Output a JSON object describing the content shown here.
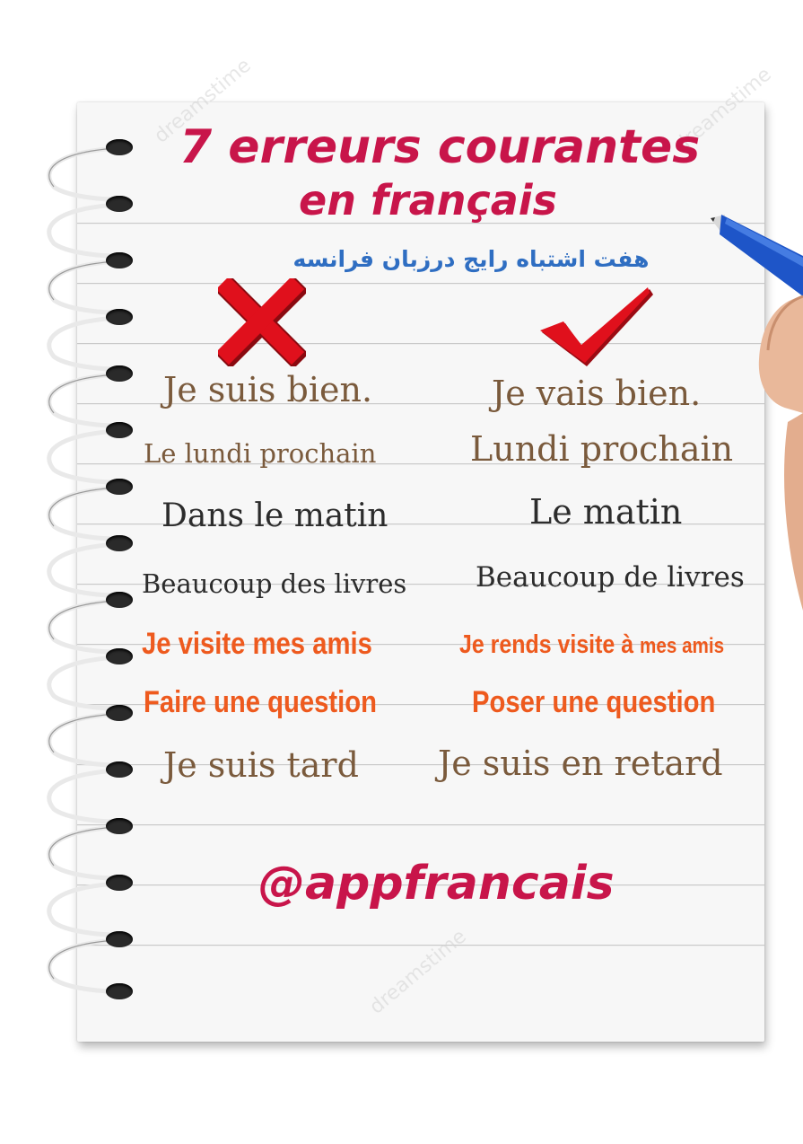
{
  "title": {
    "line1": "7 erreurs courantes",
    "line2": "en français",
    "persian": "هفت اشتباه رایج درزبان فرانسه"
  },
  "columns": {
    "wrong_icon": "red-x-icon",
    "right_icon": "red-checkmark-icon"
  },
  "phrases": [
    {
      "wrong": "Je suis bien.",
      "right": "Je vais bien."
    },
    {
      "wrong": "Le lundi prochain",
      "right": "Lundi prochain"
    },
    {
      "wrong": "Dans le matin",
      "right": "Le matin"
    },
    {
      "wrong": "Beaucoup des livres",
      "right": "Beaucoup de livres"
    },
    {
      "wrong": "Je visite mes amis",
      "right_part1": "Je rends visite à",
      "right_part2": "mes amis"
    },
    {
      "wrong": "Faire une question",
      "right": "Poser une question"
    },
    {
      "wrong": "Je suis tard",
      "right": "Je suis en retard"
    }
  ],
  "handle": "@appfrancais",
  "watermark": "dreamstime",
  "colors": {
    "title": "#c8154a",
    "persian": "#2f6ec2",
    "brown_text": "#7a5a3c",
    "dark_text": "#2c2c2c",
    "orange_text": "#ee5a1e",
    "wrong_mark": "#e0101c",
    "pen": "#1e55c8"
  }
}
